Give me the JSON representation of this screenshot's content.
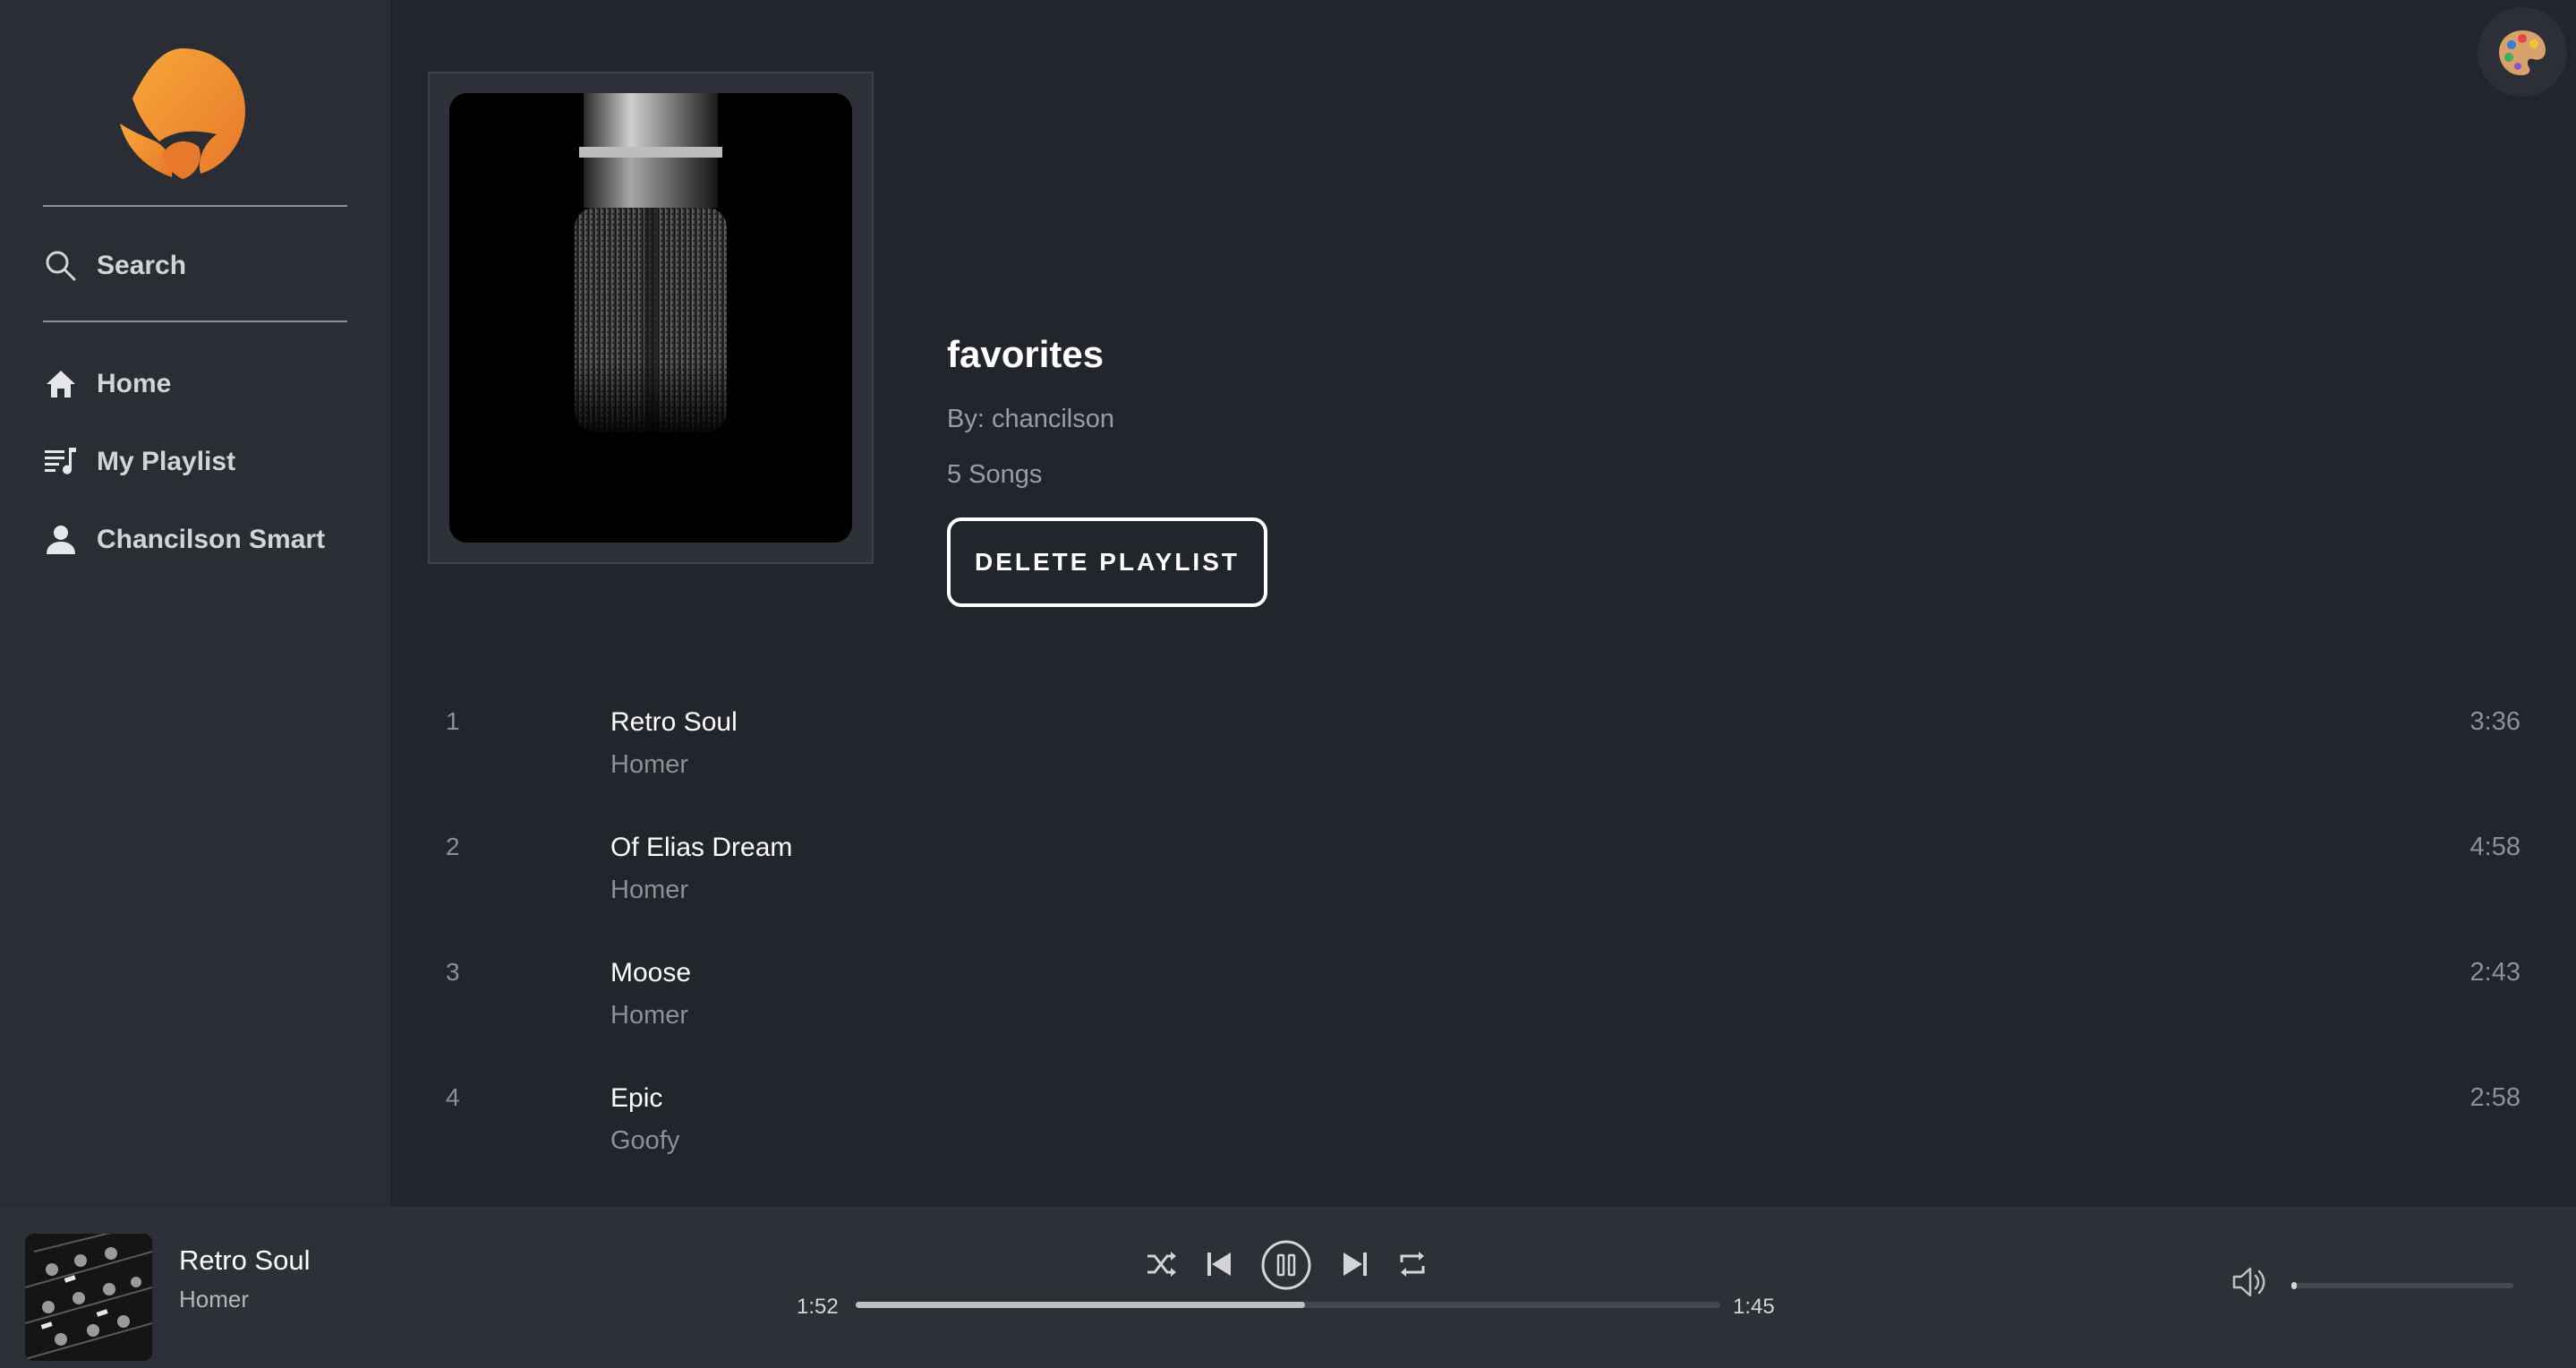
{
  "sidebar": {
    "search_label": "Search",
    "items": [
      {
        "label": "Home",
        "icon": "home-icon"
      },
      {
        "label": "My Playlist",
        "icon": "playlist-icon"
      },
      {
        "label": "Chancilson Smart",
        "icon": "user-icon"
      }
    ]
  },
  "playlist": {
    "title": "favorites",
    "owner": "By: chancilson",
    "count": "5 Songs",
    "delete_label": "DELETE PLAYLIST"
  },
  "tracks": [
    {
      "num": "1",
      "title": "Retro Soul",
      "artist": "Homer",
      "duration": "3:36"
    },
    {
      "num": "2",
      "title": "Of Elias Dream",
      "artist": "Homer",
      "duration": "4:58"
    },
    {
      "num": "3",
      "title": "Moose",
      "artist": "Homer",
      "duration": "2:43"
    },
    {
      "num": "4",
      "title": "Epic",
      "artist": "Goofy",
      "duration": "2:58"
    }
  ],
  "player": {
    "title": "Retro Soul",
    "artist": "Homer",
    "elapsed": "1:52",
    "remaining": "1:45",
    "progress": 0.52,
    "volume": 0.02
  },
  "colors": {
    "background": "#22252b",
    "sidebar": "#2a2d33",
    "player_bar": "#2d3036",
    "logo_accent": "#f0922b"
  }
}
